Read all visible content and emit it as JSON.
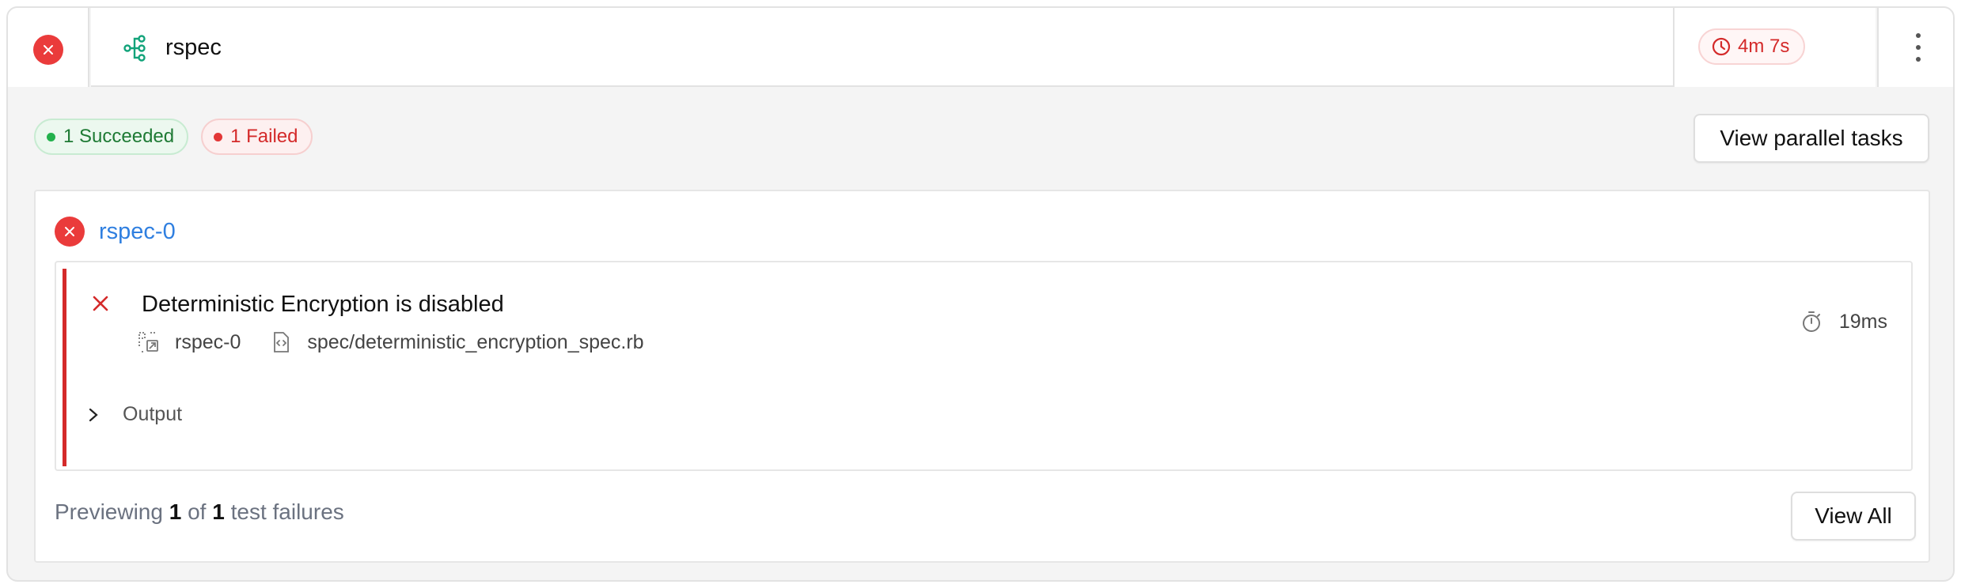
{
  "header": {
    "status": "failed",
    "title": "rspec",
    "duration": "4m 7s"
  },
  "summary": {
    "succeeded_label": "1 Succeeded",
    "failed_label": "1 Failed",
    "view_parallel_label": "View parallel tasks"
  },
  "job": {
    "name": "rspec-0",
    "failure": {
      "title": "Deterministic Encryption is disabled",
      "job_name": "rspec-0",
      "file": "spec/deterministic_encryption_spec.rb",
      "duration": "19ms",
      "output_label": "Output"
    }
  },
  "footer": {
    "prefix": "Previewing",
    "shown": "1",
    "of": "of",
    "total": "1",
    "suffix": "test failures",
    "view_all_label": "View All"
  },
  "colors": {
    "fail": "#ea3b3b",
    "success": "#22b14c",
    "link": "#2f7fe0",
    "step_icon": "#12a37a"
  }
}
